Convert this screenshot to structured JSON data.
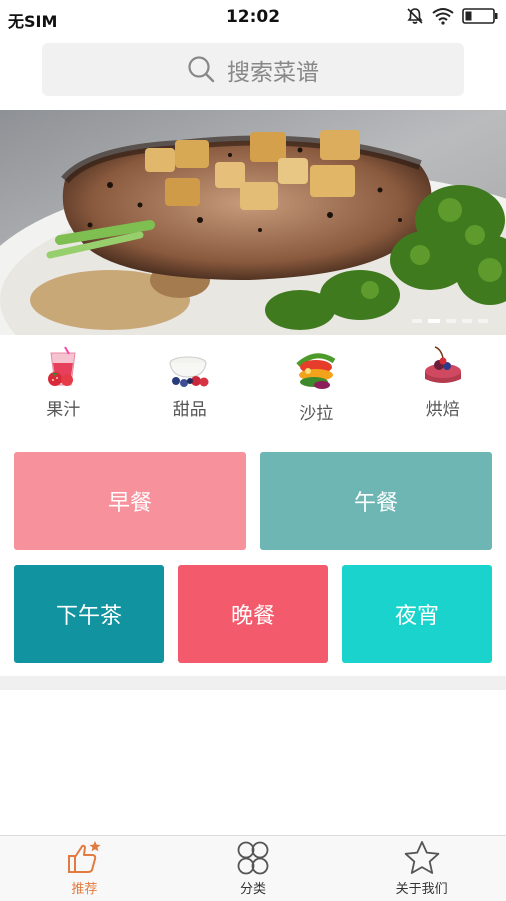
{
  "status": {
    "carrier": "无SIM",
    "time": "12:02"
  },
  "search": {
    "placeholder": "搜索菜谱"
  },
  "banner": {
    "slides": 5,
    "active_index": 1
  },
  "categories": [
    {
      "label": "果汁",
      "icon": "juice-icon"
    },
    {
      "label": "甜品",
      "icon": "dessert-icon"
    },
    {
      "label": "沙拉",
      "icon": "salad-icon"
    },
    {
      "label": "烘焙",
      "icon": "cake-icon"
    }
  ],
  "meals": {
    "breakfast": {
      "label": "早餐",
      "color": "#f7919c"
    },
    "lunch": {
      "label": "午餐",
      "color": "#6db6b4"
    },
    "tea": {
      "label": "下午茶",
      "color": "#11949f"
    },
    "dinner": {
      "label": "晚餐",
      "color": "#f35b6c"
    },
    "supper": {
      "label": "夜宵",
      "color": "#1ad3cc"
    }
  },
  "tabbar": {
    "items": [
      {
        "label": "推荐",
        "icon": "thumbs-up-icon",
        "active": true
      },
      {
        "label": "分类",
        "icon": "grid-icon",
        "active": false
      },
      {
        "label": "关于我们",
        "icon": "star-icon",
        "active": false
      }
    ],
    "active_color": "#e27b3f"
  }
}
